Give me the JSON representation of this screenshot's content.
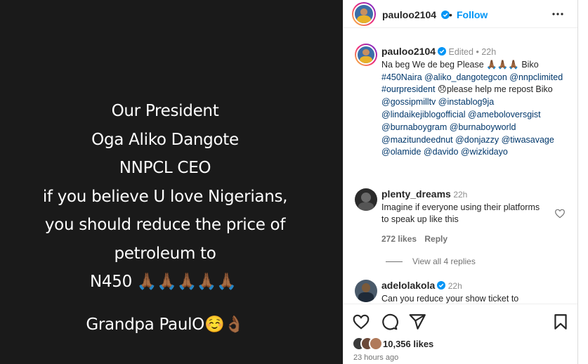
{
  "post": {
    "lines": [
      "Our President",
      "Oga Aliko Dangote",
      "NNPCL CEO",
      "if you believe U love Nigerians,",
      "you should reduce the price of",
      "petroleum to"
    ],
    "price_line": "N450 🙏🏾🙏🏾🙏🏾🙏🏾🙏🏾",
    "signature": "Grandpa PaulO☺️👌🏾"
  },
  "header": {
    "username": "pauloo2104",
    "separator": "•",
    "follow_label": "Follow"
  },
  "caption": {
    "username": "pauloo2104",
    "edited": "Edited",
    "separator": "•",
    "time": "22h",
    "text_start": "Na beg We de beg Please 🙏🏾🙏🏾🙏🏾 Biko ",
    "tags_1": "#450Naira @aliko_dangotegcon @nnpclimited #ourpresident",
    "text_mid": " 😞please help me repost Biko ",
    "tags_2": "@gossipmilltv @instablog9ja @lindaikejiblogofficial @ameboloversgist @burnaboygram @burnaboyworld @mazitundeednut @donjazzy @tiwasavage @olamide @davido @wizkidayo"
  },
  "comments": [
    {
      "username": "plenty_dreams",
      "time": "22h",
      "text": "Imagine if everyone using their platforms to speak up like this",
      "likes": "272 likes",
      "reply_label": "Reply",
      "view_replies": "View all 4 replies"
    },
    {
      "username": "adelolakola",
      "time": "22h",
      "text": "Can you reduce your show ticket to"
    }
  ],
  "actions": {
    "likes_count": "10,356 likes",
    "time_ago": "23 hours ago"
  },
  "colors": {
    "accent": "#0095f6",
    "link": "#00376b",
    "verified": "#0095f6",
    "post_bg": "#1a1a1a"
  }
}
